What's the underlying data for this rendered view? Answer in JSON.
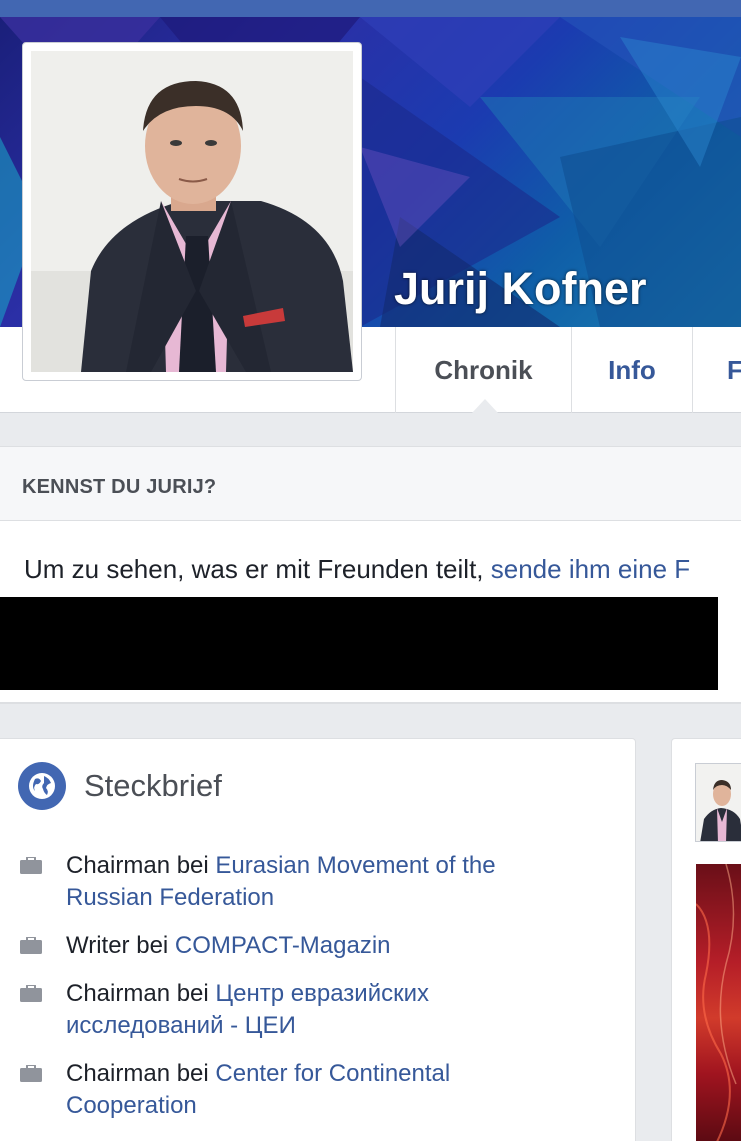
{
  "colors": {
    "topbar": "#4267b2",
    "link": "#365899",
    "text": "#1d2129",
    "muted": "#4b4f56",
    "page_bg": "#e9ebee"
  },
  "header": {
    "profile_name": "Jurij Kofner"
  },
  "tabs": [
    {
      "label": "Chronik",
      "active": true
    },
    {
      "label": "Info",
      "active": false
    },
    {
      "label": "F",
      "active": false
    }
  ],
  "kennst": {
    "title": "KENNST DU JURIJ?",
    "text": "Um zu sehen, was er mit Freunden teilt, ",
    "link": "sende ihm eine F"
  },
  "steckbrief": {
    "title": "Steckbrief",
    "icon": "globe-icon",
    "items": [
      {
        "role": "Chairman bei ",
        "org": "Eurasian Movement of the Russian Federation",
        "icon": "briefcase-icon"
      },
      {
        "role": "Writer bei ",
        "org": "COMPACT-Magazin",
        "icon": "briefcase-icon"
      },
      {
        "role": "Chairman bei ",
        "org": "Центр евразийских исследований - ЦЕИ",
        "icon": "briefcase-icon"
      },
      {
        "role": "Chairman bei ",
        "org": "Center for Continental Cooperation",
        "icon": "briefcase-icon"
      }
    ]
  }
}
